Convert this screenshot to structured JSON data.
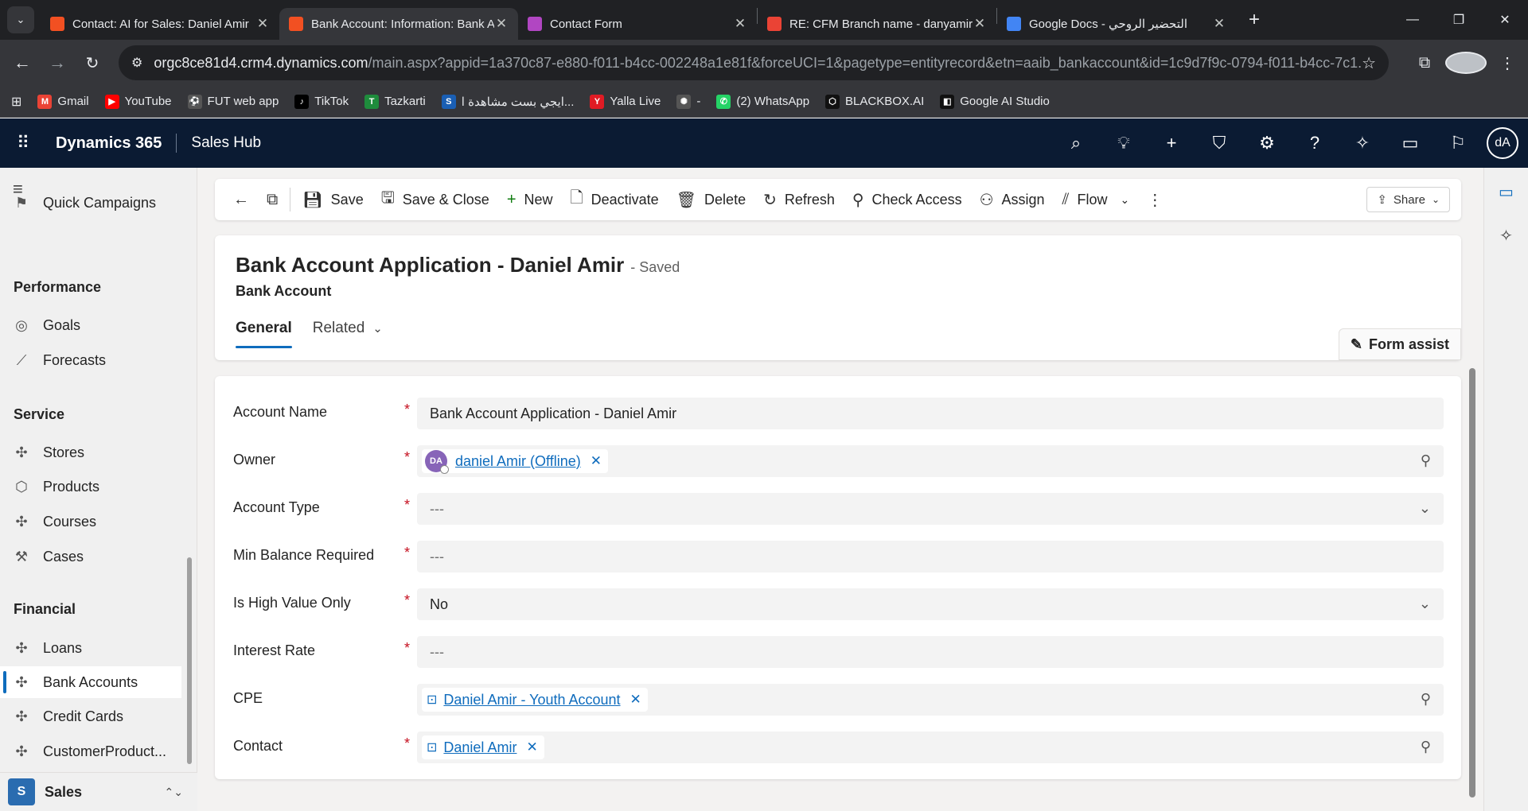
{
  "browser": {
    "tabs": [
      {
        "title": "Contact: AI for Sales: Daniel Amir",
        "color": "#f25022",
        "active": false
      },
      {
        "title": "Bank Account: Information: Bank Account Application",
        "color": "#f25022",
        "active": true
      },
      {
        "title": "Contact Form",
        "color": "#b146c2",
        "active": false
      },
      {
        "title": "RE: CFM Branch name - danyamir",
        "color": "#ea4335",
        "active": false
      },
      {
        "title": "Google Docs - التحضير الروحي",
        "color": "#4285f4",
        "active": false
      }
    ],
    "url_host": "orgc8ce81d4.crm4.dynamics.com",
    "url_path": "/main.aspx?appid=1a370c87-e880-f011-b4cc-002248a1e81f&forceUCI=1&pagetype=entityrecord&etn=aaib_bankaccount&id=1c9d7f9c-0794-f011-b4cc-7c1...",
    "bookmarks": [
      {
        "label": "Gmail",
        "color": "#ea4335",
        "glyph": "M"
      },
      {
        "label": "YouTube",
        "color": "#ff0000",
        "glyph": "▶"
      },
      {
        "label": "FUT web app",
        "color": "#555555",
        "glyph": "⚽"
      },
      {
        "label": "TikTok",
        "color": "#000000",
        "glyph": "♪"
      },
      {
        "label": "Tazkarti",
        "color": "#1e8c3c",
        "glyph": "T"
      },
      {
        "label": "ايجي بست مشاهدة ا...",
        "color": "#1a5fb4",
        "glyph": "S"
      },
      {
        "label": "Yalla Live",
        "color": "#e01b24",
        "glyph": "Y"
      },
      {
        "label": "-",
        "color": "#555555",
        "glyph": "✺"
      },
      {
        "label": "(2) WhatsApp",
        "color": "#25d366",
        "glyph": "✆"
      },
      {
        "label": "BLACKBOX.AI",
        "color": "#111111",
        "glyph": "⬡"
      },
      {
        "label": "Google AI Studio",
        "color": "#111111",
        "glyph": "◧"
      }
    ]
  },
  "app": {
    "brand": "Dynamics 365",
    "name": "Sales Hub",
    "user_initials": "dA"
  },
  "nav": {
    "quick_campaigns": "Quick Campaigns",
    "performance_head": "Performance",
    "goals": "Goals",
    "forecasts": "Forecasts",
    "service_head": "Service",
    "stores": "Stores",
    "products": "Products",
    "courses": "Courses",
    "cases": "Cases",
    "financial_head": "Financial",
    "loans": "Loans",
    "bank_accounts": "Bank Accounts",
    "credit_cards": "Credit Cards",
    "customer_products": "CustomerProduct...",
    "area_badge": "S",
    "area_label": "Sales"
  },
  "commands": {
    "save": "Save",
    "save_close": "Save & Close",
    "new": "New",
    "deactivate": "Deactivate",
    "delete": "Delete",
    "refresh": "Refresh",
    "check_access": "Check Access",
    "assign": "Assign",
    "flow": "Flow",
    "share": "Share"
  },
  "record": {
    "title": "Bank Account Application - Daniel Amir",
    "status": "- Saved",
    "entity": "Bank Account",
    "tab_general": "General",
    "tab_related": "Related",
    "form_assist": "Form assist"
  },
  "form": {
    "account_name_label": "Account Name",
    "account_name_value": "Bank Account Application - Daniel Amir",
    "owner_label": "Owner",
    "owner_initials": "DA",
    "owner_value": "daniel Amir (Offline)",
    "account_type_label": "Account Type",
    "account_type_value": "---",
    "min_balance_label": "Min Balance Required",
    "min_balance_value": "---",
    "high_value_label": "Is High Value Only",
    "high_value_value": "No",
    "interest_rate_label": "Interest Rate",
    "interest_rate_value": "---",
    "cpe_label": "CPE",
    "cpe_value": "Daniel Amir - Youth Account",
    "contact_label": "Contact",
    "contact_value": "Daniel Amir",
    "required_mark": "*"
  }
}
